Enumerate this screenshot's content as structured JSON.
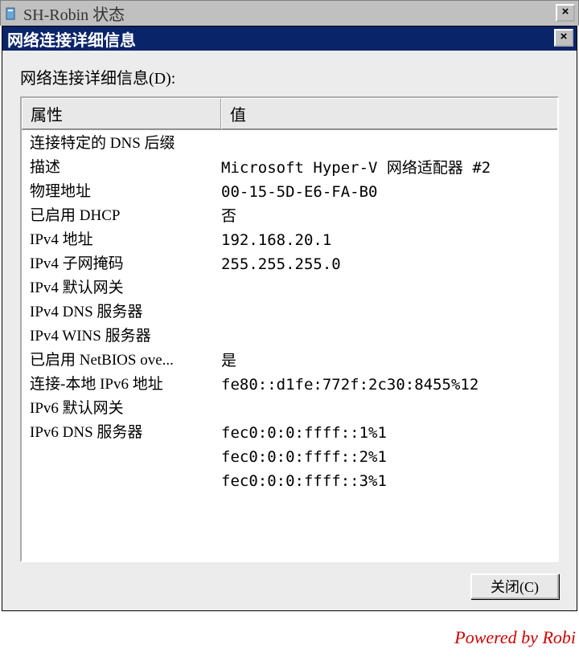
{
  "outerWindow": {
    "title": "SH-Robin 状态",
    "closeGlyph": "×"
  },
  "dialog": {
    "title": "网络连接详细信息",
    "closeGlyph": "×",
    "labelAbove": "网络连接详细信息(D):",
    "columns": {
      "property": "属性",
      "value": "值"
    },
    "rows": [
      {
        "prop": "连接特定的 DNS 后缀",
        "val": ""
      },
      {
        "prop": "描述",
        "val": "Microsoft Hyper-V 网络适配器 #2"
      },
      {
        "prop": "物理地址",
        "val": "00-15-5D-E6-FA-B0"
      },
      {
        "prop": "已启用 DHCP",
        "val": "否"
      },
      {
        "prop": "IPv4 地址",
        "val": "192.168.20.1"
      },
      {
        "prop": "IPv4 子网掩码",
        "val": "255.255.255.0"
      },
      {
        "prop": "IPv4 默认网关",
        "val": ""
      },
      {
        "prop": "IPv4 DNS 服务器",
        "val": ""
      },
      {
        "prop": "IPv4 WINS 服务器",
        "val": ""
      },
      {
        "prop": "已启用 NetBIOS ove...",
        "val": "是"
      },
      {
        "prop": "连接-本地 IPv6 地址",
        "val": "fe80::d1fe:772f:2c30:8455%12"
      },
      {
        "prop": "IPv6 默认网关",
        "val": ""
      },
      {
        "prop": "IPv6 DNS 服务器",
        "val": "fec0:0:0:ffff::1%1"
      },
      {
        "prop": "",
        "val": "fec0:0:0:ffff::2%1"
      },
      {
        "prop": "",
        "val": "fec0:0:0:ffff::3%1"
      }
    ],
    "closeButton": "关闭(C)"
  },
  "watermark": "Powered by Robi"
}
